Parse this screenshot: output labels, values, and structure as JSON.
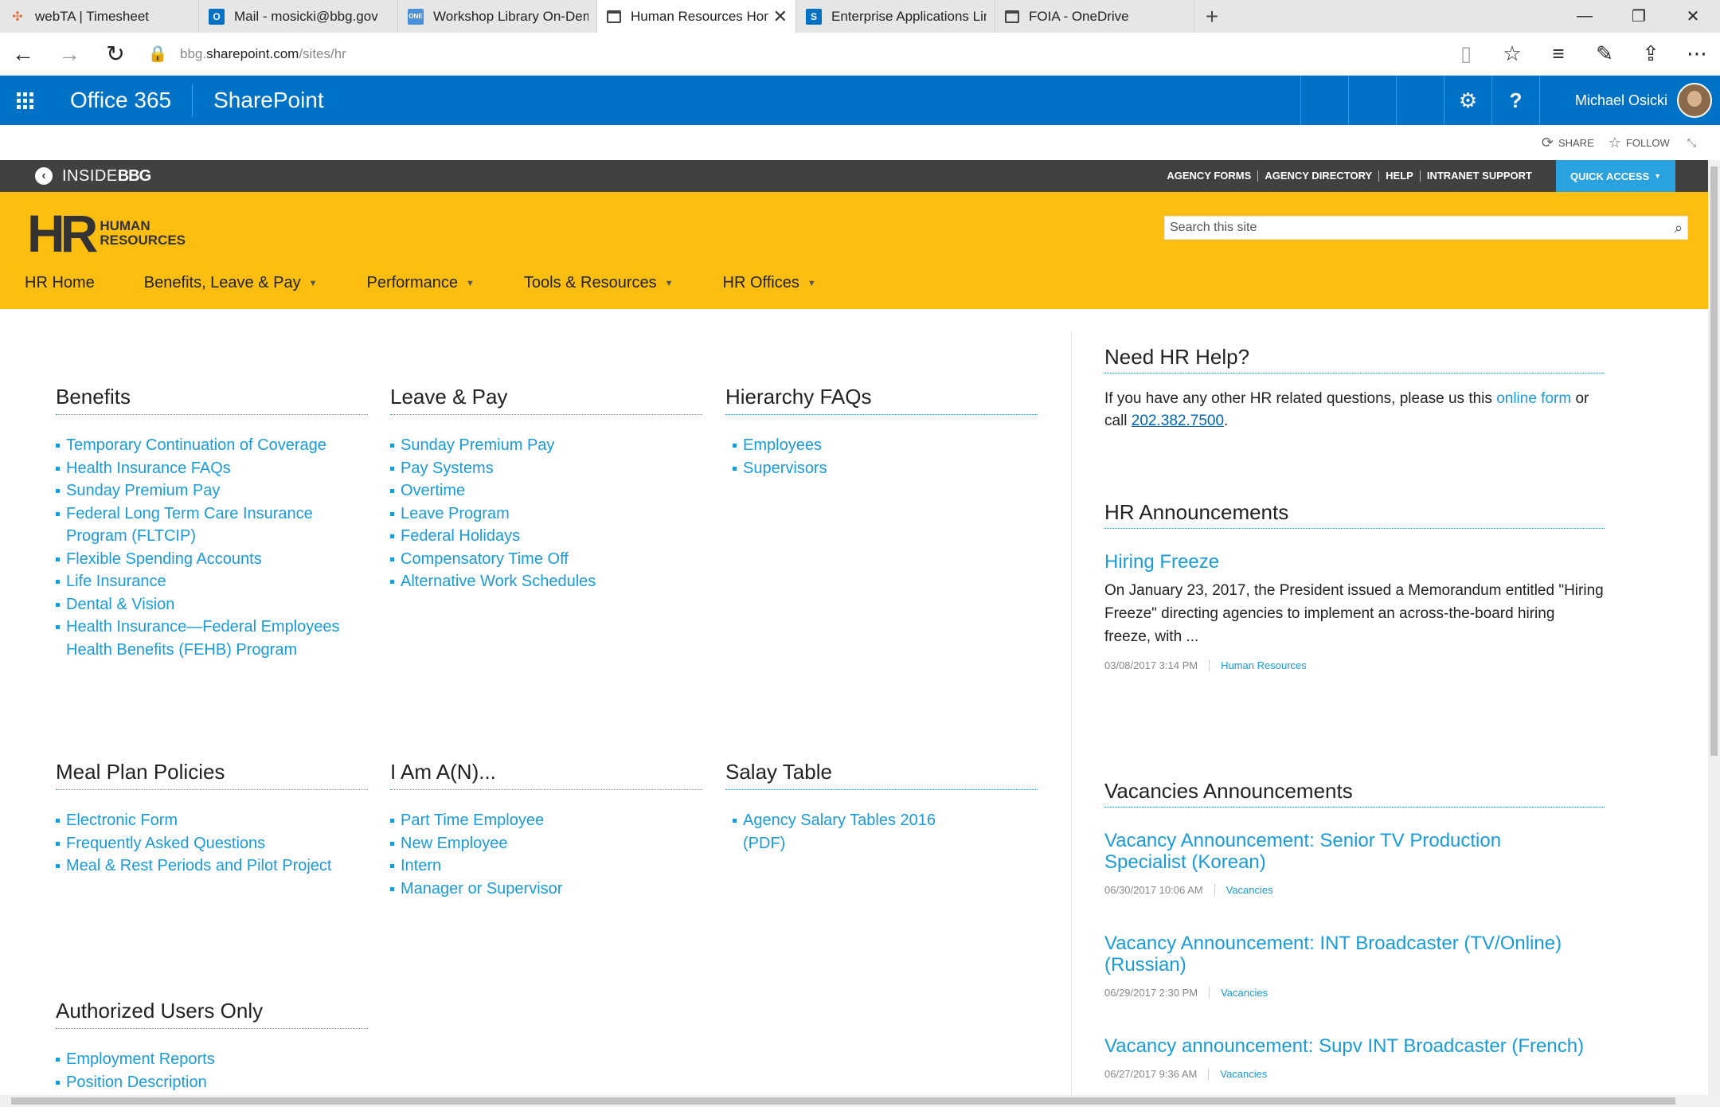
{
  "browser": {
    "tabs": [
      {
        "label": "webTA | Timesheet",
        "icon": "webta-icon",
        "color": "#e0703a"
      },
      {
        "label": "Mail - mosicki@bbg.gov",
        "icon": "outlook-icon",
        "color": "#0072c6"
      },
      {
        "label": "Workshop Library On-Dema",
        "icon": "workshop-icon",
        "color": "#4a90d9"
      },
      {
        "label": "Human Resources Hom",
        "icon": "page-icon",
        "color": "#444444"
      },
      {
        "label": "Enterprise Applications Limi",
        "icon": "sharepoint-icon",
        "color": "#0072c6"
      },
      {
        "label": "FOIA - OneDrive",
        "icon": "page-icon",
        "color": "#444444"
      }
    ],
    "url_prefix": "bbg.",
    "url_domain": "sharepoint.com",
    "url_path": "/sites/hr"
  },
  "suite": {
    "office": "Office 365",
    "app": "SharePoint",
    "user": "Michael Osicki"
  },
  "share": {
    "share_label": "SHARE",
    "follow_label": "FOLLOW"
  },
  "inside": {
    "logo_a": "INSIDE",
    "logo_b": "BBG",
    "links": [
      "AGENCY FORMS",
      "AGENCY DIRECTORY",
      "HELP",
      "INTRANET SUPPORT"
    ],
    "quick_access": "QUICK ACCESS"
  },
  "hr": {
    "logo_big": "HR",
    "logo_line1": "HUMAN",
    "logo_line2": "RESOURCES",
    "search_placeholder": "Search this site",
    "nav": [
      "HR Home",
      "Benefits, Leave & Pay",
      "Performance",
      "Tools & Resources",
      "HR Offices"
    ]
  },
  "sections": {
    "benefits": {
      "title": "Benefits",
      "items": [
        "Temporary Continuation of Coverage",
        "Health Insurance FAQs",
        "Sunday Premium Pay",
        "Federal Long Term Care Insurance Program (FLTCIP)",
        "Flexible Spending Accounts",
        "Life Insurance",
        "Dental & Vision",
        "Health Insurance—Federal Employees Health Benefits (FEHB) Program"
      ]
    },
    "leave": {
      "title": "Leave & Pay",
      "items": [
        "Sunday Premium Pay",
        "Pay Systems",
        "Overtime",
        "Leave Program",
        "Federal Holidays",
        "Compensatory Time Off",
        "Alternative Work Schedules"
      ]
    },
    "hierarchy": {
      "title": "Hierarchy FAQs",
      "items": [
        "Employees",
        "Supervisors"
      ]
    },
    "meal": {
      "title": "Meal Plan Policies",
      "items": [
        "Electronic Form",
        "Frequently Asked Questions",
        "Meal & Rest Periods and Pilot Project"
      ]
    },
    "iam": {
      "title": "I Am A(N)...",
      "items": [
        "Part Time Employee",
        "New Employee",
        "Intern",
        "Manager or Supervisor"
      ]
    },
    "salary": {
      "title": "Salay Table",
      "items": [
        "Agency Salary Tables 2016 (PDF)"
      ]
    },
    "authorized": {
      "title": "Authorized Users Only",
      "items": [
        "Employment Reports",
        "Position Description"
      ]
    }
  },
  "help": {
    "title": "Need HR Help?",
    "text_before": "If you have any other HR related questions, please us this ",
    "link": "online form",
    "text_mid": " or call ",
    "phone": "202.382.7500",
    "text_after": "."
  },
  "announcements": {
    "title": "HR Announcements",
    "item_title": "Hiring Freeze",
    "item_body": "On January 23, 2017, the President issued a Memorandum entitled \"Hiring Freeze\" directing agencies to implement an across-the-board hiring freeze, with ...",
    "item_date": "03/08/2017 3:14 PM",
    "item_cat": "Human Resources"
  },
  "vacancies": {
    "title": "Vacancies Announcements",
    "items": [
      {
        "title": "Vacancy Announcement: Senior TV Production Specialist (Korean)",
        "date": "06/30/2017 10:06 AM",
        "cat": "Vacancies"
      },
      {
        "title": "Vacancy Announcement: INT Broadcaster (TV/Online) (Russian)",
        "date": "06/29/2017 2:30 PM",
        "cat": "Vacancies"
      },
      {
        "title": "Vacancy announcement: Supv INT Broadcaster (French)",
        "date": "06/27/2017 9:36 AM",
        "cat": "Vacancies"
      }
    ]
  },
  "colors": {
    "suite_blue": "#0072c6",
    "hr_yellow": "#fdbe12",
    "link_blue": "#1a9bd7",
    "quick_access": "#2aa2e0",
    "inside_bar": "#414141"
  }
}
